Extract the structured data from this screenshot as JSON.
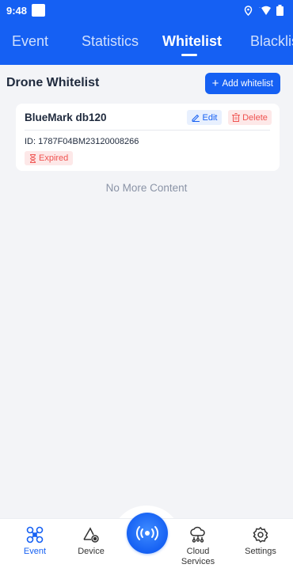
{
  "status_bar": {
    "time": "9:48"
  },
  "tabs": [
    {
      "label": "Event",
      "active": false
    },
    {
      "label": "Statistics",
      "active": false
    },
    {
      "label": "Whitelist",
      "active": true
    },
    {
      "label": "Blacklis",
      "active": false
    }
  ],
  "section": {
    "title": "Drone Whitelist",
    "add_button": "Add whitelist"
  },
  "whitelist": [
    {
      "name": "BlueMark db120",
      "edit_label": "Edit",
      "delete_label": "Delete",
      "id_text": "ID: 1787F04BM23120008266",
      "status": "Expired"
    }
  ],
  "empty_text": "No More Content",
  "bottom_nav": {
    "items": [
      {
        "label": "Event",
        "icon": "drone-icon",
        "active": true
      },
      {
        "label": "Device",
        "icon": "device-icon",
        "active": false
      },
      {
        "label": "Cloud Services",
        "icon": "cloud-icon",
        "active": false
      },
      {
        "label": "Settings",
        "icon": "gear-icon",
        "active": false
      }
    ],
    "center_icon": "radar-broadcast-icon"
  },
  "colors": {
    "primary": "#1560f3",
    "danger": "#ef5350",
    "background": "#f3f4f7"
  }
}
